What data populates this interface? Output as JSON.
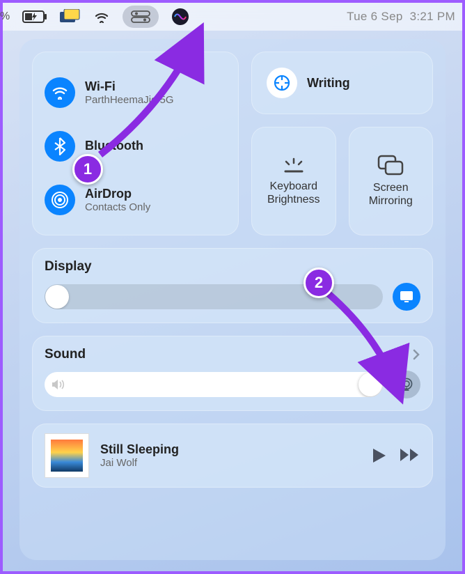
{
  "menubar": {
    "percent_suffix": "%",
    "date": "Tue 6 Sep",
    "time": "3:21 PM"
  },
  "connectivity": {
    "wifi": {
      "title": "Wi-Fi",
      "sub": "ParthHeemaJio 5G"
    },
    "bluetooth": {
      "title": "Bluetooth"
    },
    "airdrop": {
      "title": "AirDrop",
      "sub": "Contacts Only"
    }
  },
  "focus": {
    "label": "Writing"
  },
  "keyboard_brightness": {
    "label": "Keyboard Brightness"
  },
  "screen_mirroring": {
    "label": "Screen Mirroring"
  },
  "display": {
    "title": "Display"
  },
  "sound": {
    "title": "Sound"
  },
  "now_playing": {
    "track": "Still Sleeping",
    "artist": "Jai Wolf"
  },
  "annotations": {
    "badge1": "1",
    "badge2": "2"
  }
}
